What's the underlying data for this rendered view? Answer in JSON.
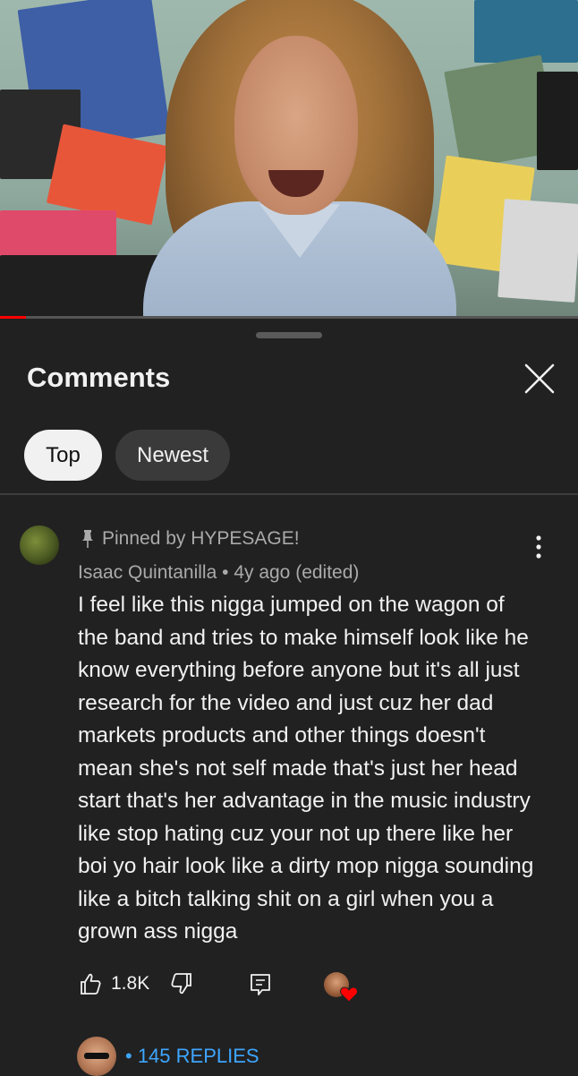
{
  "video": {
    "progress_fraction": 0.045,
    "progress_color": "#ff0000"
  },
  "sheet": {
    "title": "Comments",
    "close_icon": "close-icon",
    "sort_chips": [
      {
        "label": "Top",
        "selected": true
      },
      {
        "label": "Newest",
        "selected": false
      }
    ]
  },
  "comment": {
    "pinned_label": "Pinned by HYPESAGE!",
    "author": "Isaac Quintanilla",
    "separator": "•",
    "age": "4y ago (edited)",
    "text": "I feel like this nigga jumped on the wagon of the band and tries to make himself look like he know everything before anyone but it's all just research for the video and just cuz her dad markets products and other things doesn't mean she's not self made that's just her head start that's her advantage in the music industry like stop hating cuz your not up there like her boi yo hair look like a dirty mop nigga sounding like a bitch talking shit on a girl when you a grown ass nigga",
    "like_count": "1.8K",
    "replies_label": "• 145 REPLIES"
  },
  "colors": {
    "background": "#212121",
    "link": "#3ea6ff",
    "heart": "#ff0000"
  }
}
